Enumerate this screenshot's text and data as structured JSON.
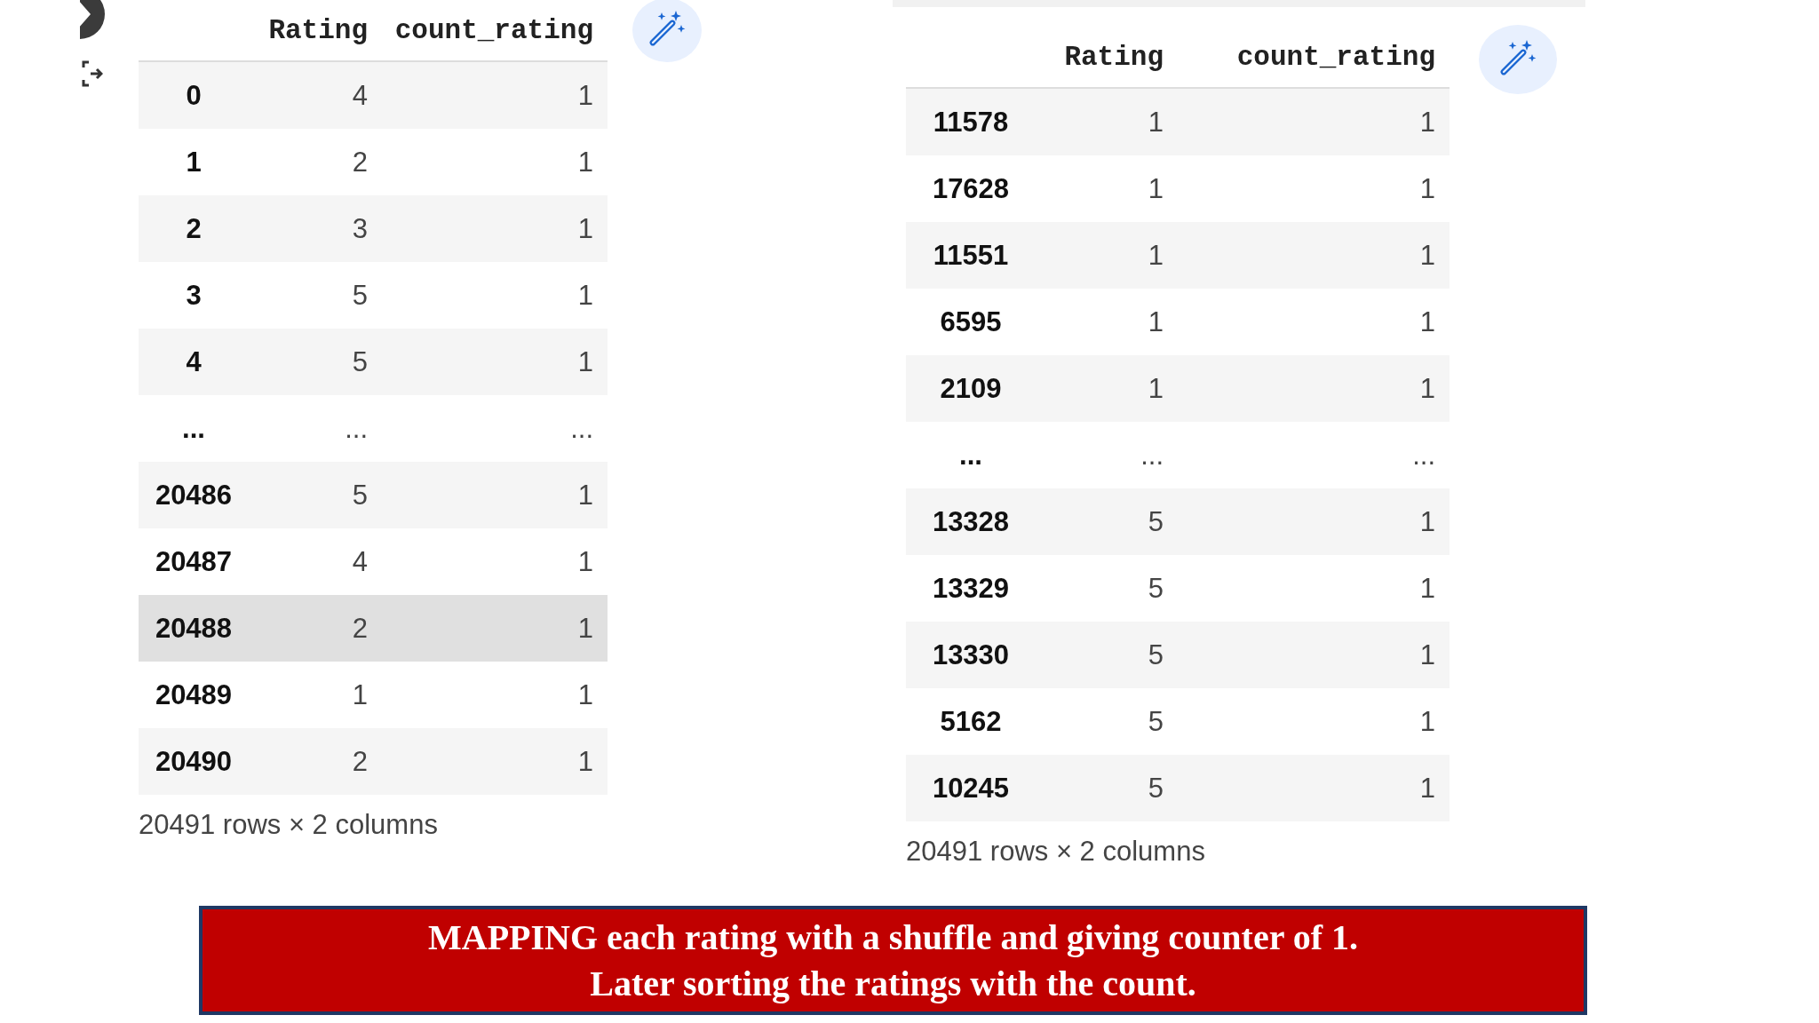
{
  "tables": [
    {
      "columns": [
        "Rating",
        "count_rating"
      ],
      "rows": [
        {
          "index": "0",
          "cells": [
            "4",
            "1"
          ],
          "highlighted": false
        },
        {
          "index": "1",
          "cells": [
            "2",
            "1"
          ],
          "highlighted": false
        },
        {
          "index": "2",
          "cells": [
            "3",
            "1"
          ],
          "highlighted": false
        },
        {
          "index": "3",
          "cells": [
            "5",
            "1"
          ],
          "highlighted": false
        },
        {
          "index": "4",
          "cells": [
            "5",
            "1"
          ],
          "highlighted": false
        },
        {
          "index": "...",
          "cells": [
            "...",
            "..."
          ],
          "highlighted": false
        },
        {
          "index": "20486",
          "cells": [
            "5",
            "1"
          ],
          "highlighted": false
        },
        {
          "index": "20487",
          "cells": [
            "4",
            "1"
          ],
          "highlighted": false
        },
        {
          "index": "20488",
          "cells": [
            "2",
            "1"
          ],
          "highlighted": true
        },
        {
          "index": "20489",
          "cells": [
            "1",
            "1"
          ],
          "highlighted": false
        },
        {
          "index": "20490",
          "cells": [
            "2",
            "1"
          ],
          "highlighted": false
        }
      ],
      "footer": "20491 rows × 2 columns"
    },
    {
      "columns": [
        "Rating",
        "count_rating"
      ],
      "rows": [
        {
          "index": "11578",
          "cells": [
            "1",
            "1"
          ],
          "highlighted": false
        },
        {
          "index": "17628",
          "cells": [
            "1",
            "1"
          ],
          "highlighted": false
        },
        {
          "index": "11551",
          "cells": [
            "1",
            "1"
          ],
          "highlighted": false
        },
        {
          "index": "6595",
          "cells": [
            "1",
            "1"
          ],
          "highlighted": false
        },
        {
          "index": "2109",
          "cells": [
            "1",
            "1"
          ],
          "highlighted": false
        },
        {
          "index": "...",
          "cells": [
            "...",
            "..."
          ],
          "highlighted": false
        },
        {
          "index": "13328",
          "cells": [
            "5",
            "1"
          ],
          "highlighted": false
        },
        {
          "index": "13329",
          "cells": [
            "5",
            "1"
          ],
          "highlighted": false
        },
        {
          "index": "13330",
          "cells": [
            "5",
            "1"
          ],
          "highlighted": false
        },
        {
          "index": "5162",
          "cells": [
            "5",
            "1"
          ],
          "highlighted": false
        },
        {
          "index": "10245",
          "cells": [
            "5",
            "1"
          ],
          "highlighted": false
        }
      ],
      "footer": "20491 rows × 2 columns"
    }
  ],
  "caption": [
    "MAPPING each rating with a shuffle and giving counter of 1.",
    "Later sorting the ratings with the count."
  ]
}
